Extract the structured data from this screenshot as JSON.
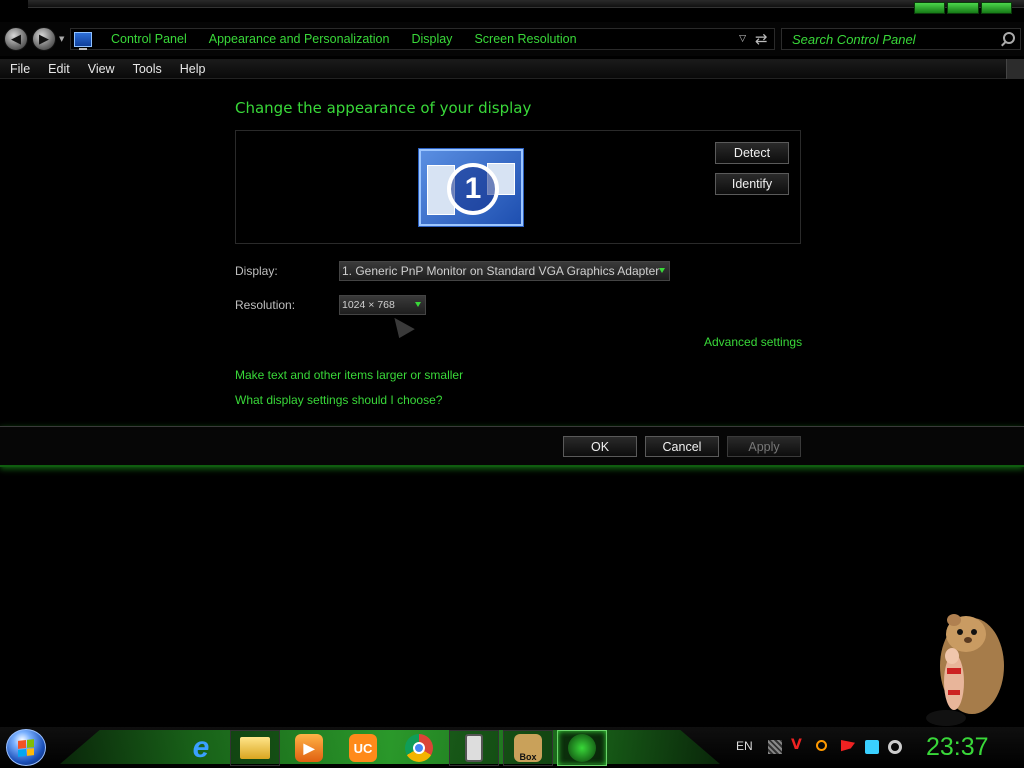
{
  "address_bar": {
    "breadcrumbs": [
      "Control Panel",
      "Appearance and Personalization",
      "Display",
      "Screen Resolution"
    ],
    "search_placeholder": "Search Control Panel"
  },
  "menubar": {
    "items": [
      "File",
      "Edit",
      "View",
      "Tools",
      "Help"
    ]
  },
  "main": {
    "title": "Change the appearance of your display",
    "monitor_number": "1",
    "detect_label": "Detect",
    "identify_label": "Identify",
    "display_label": "Display:",
    "display_value": "1. Generic PnP Monitor on Standard VGA Graphics Adapter",
    "resolution_label": "Resolution:",
    "resolution_value": "1024 × 768",
    "advanced_link": "Advanced settings",
    "text_size_link": "Make text and other items larger or smaller",
    "help_link": "What display settings should I choose?"
  },
  "buttons": {
    "ok": "OK",
    "cancel": "Cancel",
    "apply": "Apply"
  },
  "taskbar": {
    "pinned_apps": [
      {
        "name": "Internet Explorer",
        "icon": "ie-icon"
      },
      {
        "name": "File Explorer",
        "icon": "folder-icon"
      },
      {
        "name": "Media Player",
        "icon": "media-player-icon"
      },
      {
        "name": "UC Browser",
        "icon": "uc-browser-icon"
      },
      {
        "name": "Chrome",
        "icon": "chrome-icon"
      },
      {
        "name": "Phone Tool",
        "icon": "phone-tool-icon"
      },
      {
        "name": "Box",
        "icon": "box-icon",
        "label": "Box"
      },
      {
        "name": "Screen Resolution",
        "icon": "control-panel-icon"
      }
    ],
    "language": "EN",
    "clock": "23:37"
  },
  "colors": {
    "accent": "#39d839",
    "background": "#000000"
  }
}
